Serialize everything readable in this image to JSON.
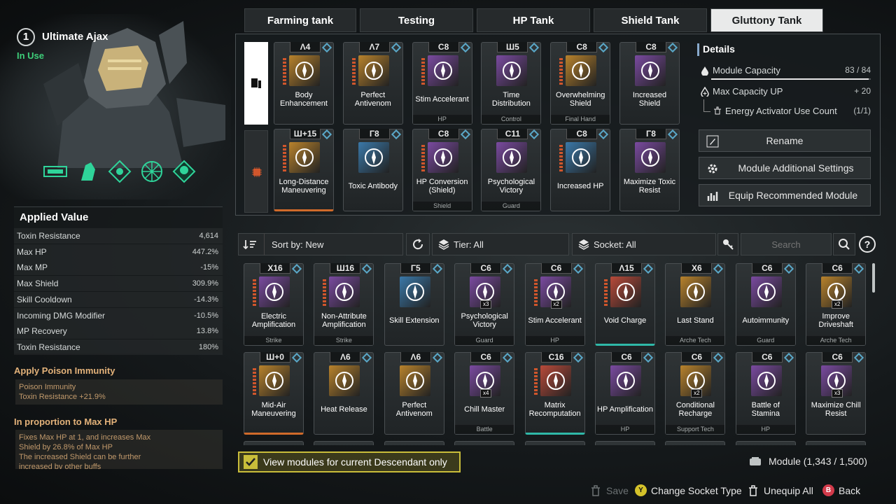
{
  "character": {
    "slot": "1",
    "name": "Ultimate Ajax",
    "status": "In Use"
  },
  "skills": [
    "skill-1-icon",
    "skill-2-icon",
    "skill-3-icon",
    "skill-4-icon",
    "skill-5-icon"
  ],
  "applied": {
    "title": "Applied Value",
    "rows": [
      {
        "label": "Toxin Resistance",
        "value": "4,614"
      },
      {
        "label": "Max HP",
        "value": "447.2%"
      },
      {
        "label": "Max MP",
        "value": "-15%"
      },
      {
        "label": "Max Shield",
        "value": "309.9%"
      },
      {
        "label": "Skill Cooldown",
        "value": "-14.3%"
      },
      {
        "label": "Incoming DMG Modifier",
        "value": "-10.5%"
      },
      {
        "label": "MP Recovery",
        "value": "13.8%"
      },
      {
        "label": "Toxin Resistance",
        "value": "180%"
      }
    ]
  },
  "poison": {
    "title": "Apply Poison Immunity",
    "line1": "Poison Immunity",
    "line2": "Toxin Resistance +21.9%"
  },
  "proportion": {
    "title": "In proportion to Max HP",
    "lines": [
      "Fixes Max HP at 1, and increases Max",
      "Shield by 26.8% of Max HP",
      "The increased Shield can be further",
      "increased by other buffs"
    ]
  },
  "tabs": [
    "Farming tank",
    "Testing",
    "HP Tank",
    "Shield Tank",
    "Gluttony Tank"
  ],
  "equipped": [
    {
      "cap": "Λ4",
      "name": "Body Enhancement",
      "sub": "",
      "color": "#b8822c",
      "bars": true,
      "border": ""
    },
    {
      "cap": "Λ7",
      "name": "Perfect Antivenom",
      "sub": "",
      "color": "#b8822c",
      "bars": true,
      "border": ""
    },
    {
      "cap": "C8",
      "name": "Stim Accelerant",
      "sub": "HP",
      "color": "#7a4aa0",
      "bars": true,
      "border": ""
    },
    {
      "cap": "Ш5",
      "name": "Time Distribution",
      "sub": "Control",
      "color": "#7a4aa0",
      "bars": false,
      "border": ""
    },
    {
      "cap": "C8",
      "name": "Overwhelming Shield",
      "sub": "Final Hand",
      "color": "#b8822c",
      "bars": true,
      "border": ""
    },
    {
      "cap": "C8",
      "name": "Increased Shield",
      "sub": "",
      "color": "#7a4aa0",
      "bars": false,
      "border": ""
    },
    {
      "cap": "Ш+15",
      "name": "Long-Distance Maneuvering",
      "sub": "",
      "color": "#b8822c",
      "bars": true,
      "border": "orange"
    },
    {
      "cap": "Γ8",
      "name": "Toxic Antibody",
      "sub": "",
      "color": "#3a78a8",
      "bars": false,
      "border": ""
    },
    {
      "cap": "C8",
      "name": "HP Conversion (Shield)",
      "sub": "Shield",
      "color": "#7a4aa0",
      "bars": true,
      "border": ""
    },
    {
      "cap": "C11",
      "name": "Psychological Victory",
      "sub": "Guard",
      "color": "#7a4aa0",
      "bars": false,
      "border": ""
    },
    {
      "cap": "C8",
      "name": "Increased HP",
      "sub": "",
      "color": "#3a78a8",
      "bars": true,
      "border": ""
    },
    {
      "cap": "Γ8",
      "name": "Maximize Toxic Resist",
      "sub": "",
      "color": "#7a4aa0",
      "bars": false,
      "border": ""
    }
  ],
  "details": {
    "title": "Details",
    "capacity_label": "Module Capacity",
    "capacity_value": "83 / 84",
    "capacity_fraction": 0.988,
    "maxcap_label": "Max Capacity UP",
    "maxcap_value": "+ 20",
    "energy_label": "Energy Activator Use Count",
    "energy_value": "(1/1)"
  },
  "buttons": {
    "rename": "Rename",
    "additional": "Module Additional Settings",
    "recommended": "Equip Recommended Module"
  },
  "filters": {
    "sort": "Sort by: New",
    "tier": "Tier: All",
    "socket": "Socket: All",
    "search_placeholder": "Search",
    "help": "?"
  },
  "modules": [
    {
      "cap": "X16",
      "name": "Electric Amplification",
      "sub": "Strike",
      "color": "#7a4aa0",
      "x": "",
      "bars": true,
      "border": ""
    },
    {
      "cap": "Ш16",
      "name": "Non-Attribute Amplification",
      "sub": "Strike",
      "color": "#7a4aa0",
      "x": "",
      "bars": true,
      "border": ""
    },
    {
      "cap": "Γ5",
      "name": "Skill Extension",
      "sub": "",
      "color": "#3a78a8",
      "x": "",
      "bars": false,
      "border": ""
    },
    {
      "cap": "C6",
      "name": "Psychological Victory",
      "sub": "Guard",
      "color": "#7a4aa0",
      "x": "x3",
      "bars": false,
      "border": ""
    },
    {
      "cap": "C6",
      "name": "Stim Accelerant",
      "sub": "HP",
      "color": "#7a4aa0",
      "x": "x2",
      "bars": true,
      "border": ""
    },
    {
      "cap": "Λ15",
      "name": "Void Charge",
      "sub": "",
      "color": "#b84a3a",
      "x": "",
      "bars": true,
      "border": "teal"
    },
    {
      "cap": "X6",
      "name": "Last Stand",
      "sub": "Arche Tech",
      "color": "#b8822c",
      "x": "",
      "bars": false,
      "border": ""
    },
    {
      "cap": "C6",
      "name": "Autoimmunity",
      "sub": "Guard",
      "color": "#7a4aa0",
      "x": "",
      "bars": false,
      "border": ""
    },
    {
      "cap": "C6",
      "name": "Improve Driveshaft",
      "sub": "Arche Tech",
      "color": "#b8822c",
      "x": "x2",
      "bars": false,
      "border": ""
    },
    {
      "cap": "Ш+0",
      "name": "Mid-Air Maneuvering",
      "sub": "",
      "color": "#b8822c",
      "x": "",
      "bars": true,
      "border": "orange"
    },
    {
      "cap": "Λ6",
      "name": "Heat Release",
      "sub": "",
      "color": "#b8822c",
      "x": "",
      "bars": false,
      "border": ""
    },
    {
      "cap": "Λ6",
      "name": "Perfect Antivenom",
      "sub": "",
      "color": "#b8822c",
      "x": "",
      "bars": false,
      "border": ""
    },
    {
      "cap": "C6",
      "name": "Chill Master",
      "sub": "Battle",
      "color": "#7a4aa0",
      "x": "x4",
      "bars": false,
      "border": ""
    },
    {
      "cap": "C16",
      "name": "Matrix Recomputation",
      "sub": "",
      "color": "#b84a3a",
      "x": "",
      "bars": true,
      "border": "teal"
    },
    {
      "cap": "C6",
      "name": "HP Amplification",
      "sub": "HP",
      "color": "#7a4aa0",
      "x": "",
      "bars": false,
      "border": ""
    },
    {
      "cap": "C6",
      "name": "Conditional Recharge",
      "sub": "Support Tech",
      "color": "#b8822c",
      "x": "x2",
      "bars": false,
      "border": ""
    },
    {
      "cap": "C6",
      "name": "Battle of Stamina",
      "sub": "HP",
      "color": "#7a4aa0",
      "x": "",
      "bars": false,
      "border": ""
    },
    {
      "cap": "C6",
      "name": "Maximize Chill Resist",
      "sub": "",
      "color": "#7a4aa0",
      "x": "x3",
      "bars": false,
      "border": ""
    }
  ],
  "view_only": "View modules for current Descendant only",
  "module_count": "Module (1,343 / 1,500)",
  "footer": {
    "save": "Save",
    "change_label": "Change Socket Type",
    "change_key": "Y",
    "unequip": "Unequip All",
    "back_key": "B",
    "back": "Back"
  }
}
